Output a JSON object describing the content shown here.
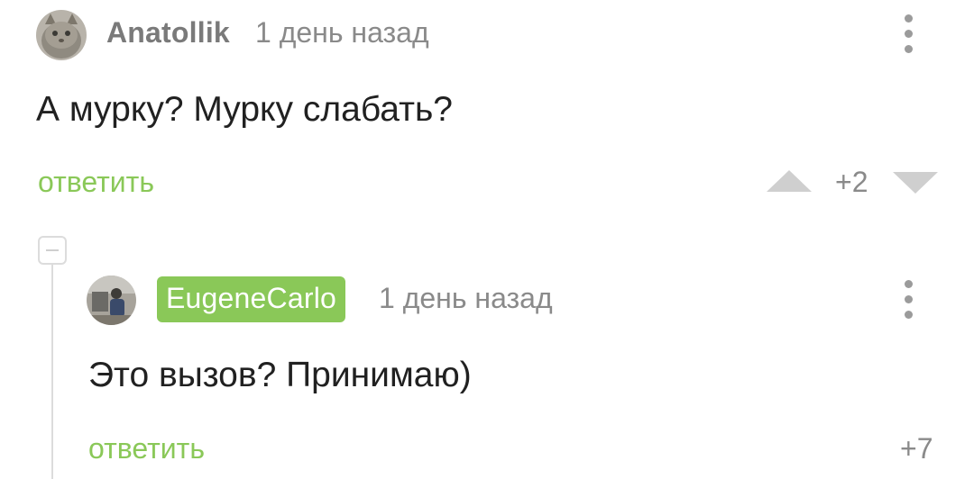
{
  "comments": [
    {
      "username": "Anatollik",
      "time": "1 день назад",
      "text": "А мурку? Мурку слабать?",
      "reply_label": "ответить",
      "rating": "+2",
      "avatar_icon": "cat-avatar-icon",
      "menu_icon": "more-vertical-icon"
    },
    {
      "username": "EugeneCarlo",
      "time": "1 день назад",
      "text": "Это вызов? Принимаю)",
      "reply_label": "ответить",
      "rating": "+7",
      "avatar_icon": "person-avatar-icon",
      "menu_icon": "more-vertical-icon",
      "username_bg_color": "#8ac858"
    }
  ],
  "colors": {
    "accent": "#8ac858",
    "muted_text": "#8a8a8a",
    "main_text": "#212121",
    "vote_arrow": "#cfcfcf"
  }
}
